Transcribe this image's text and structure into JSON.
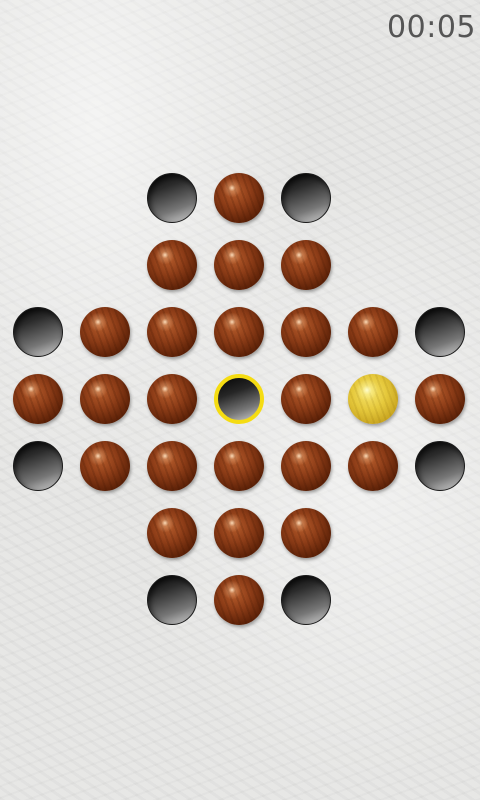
{
  "status_bar": {
    "timer": "00:05"
  },
  "colors": {
    "peg": "#8c3c17",
    "hole": "#2c2c2c",
    "selected_peg": "#e6c93c",
    "target_outline": "#f5dc12",
    "timer_text": "#555555"
  },
  "board": {
    "rows": [
      [
        "none",
        "none",
        "hole",
        "peg",
        "hole",
        "none",
        "none"
      ],
      [
        "none",
        "none",
        "peg",
        "peg",
        "peg",
        "none",
        "none"
      ],
      [
        "hole",
        "peg",
        "peg",
        "peg",
        "peg",
        "peg",
        "hole"
      ],
      [
        "peg",
        "peg",
        "peg",
        "target-hole",
        "peg",
        "selected-peg",
        "peg"
      ],
      [
        "hole",
        "peg",
        "peg",
        "peg",
        "peg",
        "peg",
        "hole"
      ],
      [
        "none",
        "none",
        "peg",
        "peg",
        "peg",
        "none",
        "none"
      ],
      [
        "none",
        "none",
        "hole",
        "peg",
        "hole",
        "none",
        "none"
      ]
    ]
  }
}
